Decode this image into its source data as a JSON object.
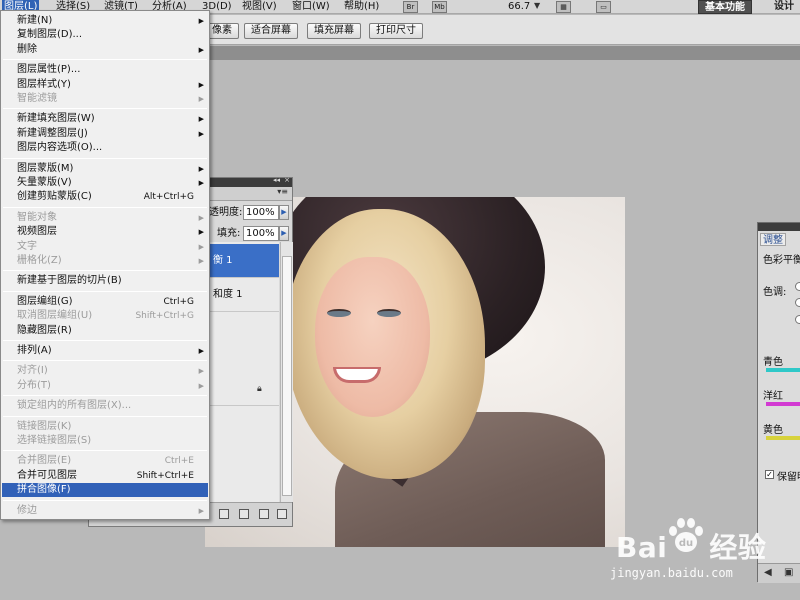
{
  "menubar": {
    "items": [
      {
        "label": "图层(L)",
        "active": true
      },
      {
        "label": "选择(S)"
      },
      {
        "label": "滤镜(T)"
      },
      {
        "label": "分析(A)"
      },
      {
        "label": "3D(D)"
      },
      {
        "label": "视图(V)"
      },
      {
        "label": "窗口(W)"
      },
      {
        "label": "帮助(H)"
      }
    ],
    "icons": [
      "Br",
      "Mb"
    ],
    "zoom": "66.7",
    "workspace": "基本功能",
    "design": "设计"
  },
  "options_bar": {
    "buttons": [
      "像素",
      "适合屏幕",
      "填充屏幕",
      "打印尺寸"
    ]
  },
  "layer_menu": {
    "groups": [
      [
        {
          "label": "新建(N)",
          "submenu": true
        },
        {
          "label": "复制图层(D)..."
        },
        {
          "label": "删除",
          "submenu": true
        }
      ],
      [
        {
          "label": "图层属性(P)..."
        },
        {
          "label": "图层样式(Y)",
          "submenu": true
        },
        {
          "label": "智能滤镜",
          "disabled": true,
          "submenu": true
        }
      ],
      [
        {
          "label": "新建填充图层(W)",
          "submenu": true
        },
        {
          "label": "新建调整图层(J)",
          "submenu": true
        },
        {
          "label": "图层内容选项(O)..."
        }
      ],
      [
        {
          "label": "图层蒙版(M)",
          "submenu": true
        },
        {
          "label": "矢量蒙版(V)",
          "submenu": true
        },
        {
          "label": "创建剪贴蒙版(C)",
          "shortcut": "Alt+Ctrl+G"
        }
      ],
      [
        {
          "label": "智能对象",
          "disabled": true,
          "submenu": true
        },
        {
          "label": "视频图层",
          "submenu": true
        },
        {
          "label": "文字",
          "disabled": true,
          "submenu": true
        },
        {
          "label": "栅格化(Z)",
          "disabled": true,
          "submenu": true
        }
      ],
      [
        {
          "label": "新建基于图层的切片(B)"
        }
      ],
      [
        {
          "label": "图层编组(G)",
          "shortcut": "Ctrl+G"
        },
        {
          "label": "取消图层编组(U)",
          "shortcut": "Shift+Ctrl+G",
          "disabled": true
        },
        {
          "label": "隐藏图层(R)"
        }
      ],
      [
        {
          "label": "排列(A)",
          "submenu": true
        }
      ],
      [
        {
          "label": "对齐(I)",
          "disabled": true,
          "submenu": true
        },
        {
          "label": "分布(T)",
          "disabled": true,
          "submenu": true
        }
      ],
      [
        {
          "label": "锁定组内的所有图层(X)...",
          "disabled": true
        }
      ],
      [
        {
          "label": "链接图层(K)",
          "disabled": true
        },
        {
          "label": "选择链接图层(S)",
          "disabled": true
        }
      ],
      [
        {
          "label": "合并图层(E)",
          "shortcut": "Ctrl+E",
          "disabled": true
        },
        {
          "label": "合并可见图层",
          "shortcut": "Shift+Ctrl+E"
        },
        {
          "label": "拼合图像(F)",
          "selected": true
        }
      ],
      [
        {
          "label": "修边",
          "disabled": true,
          "submenu": true
        }
      ]
    ]
  },
  "layers_panel": {
    "opacity_label": "透明度:",
    "opacity_value": "100%",
    "fill_label": "填充:",
    "fill_value": "100%",
    "layers": [
      "衡 1",
      "和度 1"
    ]
  },
  "adjustments_panel": {
    "tab": "调整",
    "title": "色彩平衡",
    "tone_label": "色调:",
    "labels": [
      "青色",
      "洋红",
      "黄色"
    ],
    "colors": [
      "#2fc8c8",
      "#d23ad2",
      "#d7d23c"
    ],
    "preserve_label": "保留明"
  },
  "watermark": {
    "url": "jingyan.baidu.com"
  }
}
